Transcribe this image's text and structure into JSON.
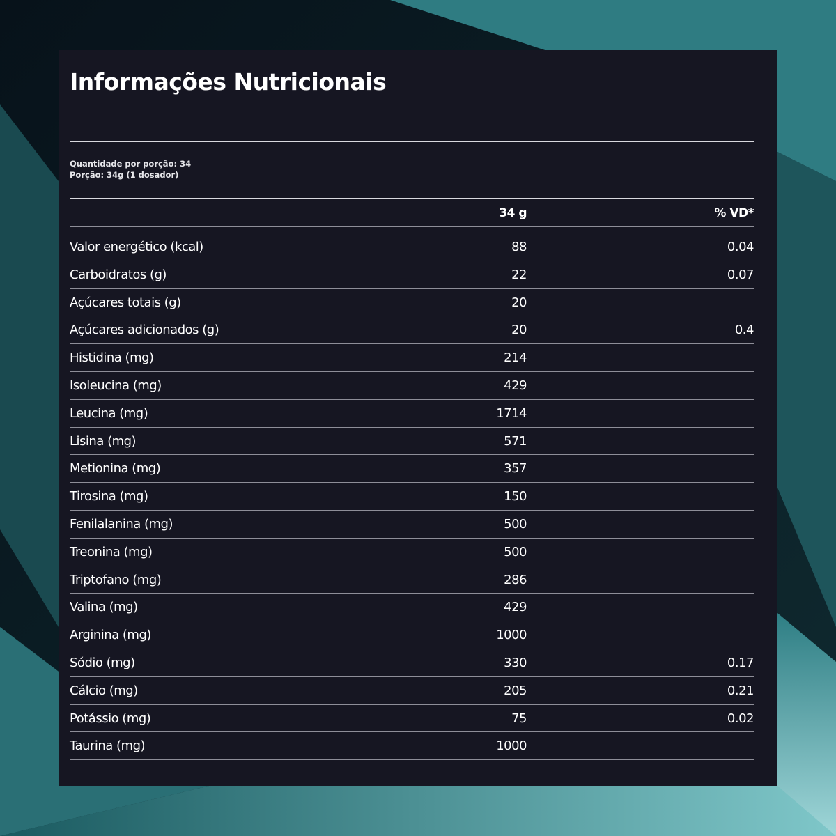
{
  "title": "Informações Nutricionais",
  "serving": {
    "line1": "Quantidade por porção: 34",
    "line2": "Porção: 34g (1 dosador)"
  },
  "columns": {
    "amount": "34 g",
    "vd": "% VD*"
  },
  "rows": [
    {
      "name": "Valor energético (kcal)",
      "amount": "88",
      "vd": "0.04"
    },
    {
      "name": "Carboidratos (g)",
      "amount": "22",
      "vd": "0.07"
    },
    {
      "name": "Açúcares totais (g)",
      "amount": "20",
      "vd": ""
    },
    {
      "name": "Açúcares adicionados (g)",
      "amount": "20",
      "vd": "0.4"
    },
    {
      "name": "Histidina (mg)",
      "amount": "214",
      "vd": ""
    },
    {
      "name": "Isoleucina (mg)",
      "amount": "429",
      "vd": ""
    },
    {
      "name": "Leucina (mg)",
      "amount": "1714",
      "vd": ""
    },
    {
      "name": "Lisina (mg)",
      "amount": "571",
      "vd": ""
    },
    {
      "name": "Metionina (mg)",
      "amount": "357",
      "vd": ""
    },
    {
      "name": "Tirosina (mg)",
      "amount": "150",
      "vd": ""
    },
    {
      "name": "Fenilalanina (mg)",
      "amount": "500",
      "vd": ""
    },
    {
      "name": "Treonina (mg)",
      "amount": "500",
      "vd": ""
    },
    {
      "name": "Triptofano (mg)",
      "amount": "286",
      "vd": ""
    },
    {
      "name": "Valina (mg)",
      "amount": "429",
      "vd": ""
    },
    {
      "name": "Arginina (mg)",
      "amount": "1000",
      "vd": ""
    },
    {
      "name": "Sódio (mg)",
      "amount": "330",
      "vd": "0.17"
    },
    {
      "name": "Cálcio (mg)",
      "amount": "205",
      "vd": "0.21"
    },
    {
      "name": "Potássio (mg)",
      "amount": "75",
      "vd": "0.02"
    },
    {
      "name": "Taurina (mg)",
      "amount": "1000",
      "vd": ""
    }
  ],
  "colors": {
    "panel": "#161622",
    "text": "#ffffff",
    "rule": "#d9d9df",
    "row_border": "#8e8e98",
    "background_teal": "#3a8f94"
  }
}
